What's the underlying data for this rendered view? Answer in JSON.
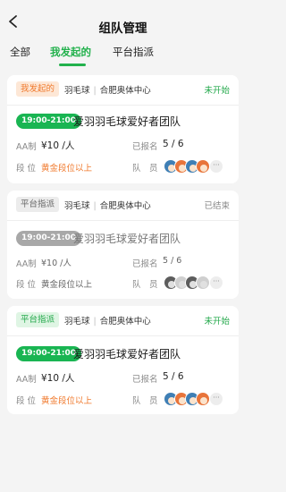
{
  "header": {
    "title": "组队管理",
    "back_icon": "chevron-left-icon"
  },
  "tabs": [
    {
      "label": "全部",
      "active": false
    },
    {
      "label": "我发起的",
      "active": true
    },
    {
      "label": "平台指派",
      "active": false
    }
  ],
  "cards": [
    {
      "source_tag": "我发起的",
      "sport": "羽毛球",
      "venue": "合肥奥体中心",
      "status": "未开始",
      "time": "19:00-21:00",
      "team_name": "爱羽羽毛球爱好者团队",
      "fee_label": "AA制",
      "fee_value": "¥10 /人",
      "signed_label": "已报名",
      "signed_value": "5 / 6",
      "level_label": "段 位",
      "level_value": "黄金段位以上",
      "members_label": "队　员",
      "more": "···"
    },
    {
      "source_tag": "平台指派",
      "sport": "羽毛球",
      "venue": "合肥奥体中心",
      "status": "已结束",
      "time": "19:00-21:00",
      "team_name": "爱羽羽毛球爱好者团队",
      "fee_label": "AA制",
      "fee_value": "¥10 /人",
      "signed_label": "已报名",
      "signed_value": "5 / 6",
      "level_label": "段 位",
      "level_value": "黄金段位以上",
      "members_label": "队　员",
      "more": "···"
    },
    {
      "source_tag": "平台指派",
      "sport": "羽毛球",
      "venue": "合肥奥体中心",
      "status": "未开始",
      "time": "19:00-21:00",
      "team_name": "爱羽羽毛球爱好者团队",
      "fee_label": "AA制",
      "fee_value": "¥10 /人",
      "signed_label": "已报名",
      "signed_value": "5 / 6",
      "level_label": "段 位",
      "level_value": "黄金段位以上",
      "members_label": "队　员",
      "more": "···"
    }
  ],
  "colors": {
    "accent": "#22b14c",
    "orange": "#f07a2e"
  }
}
